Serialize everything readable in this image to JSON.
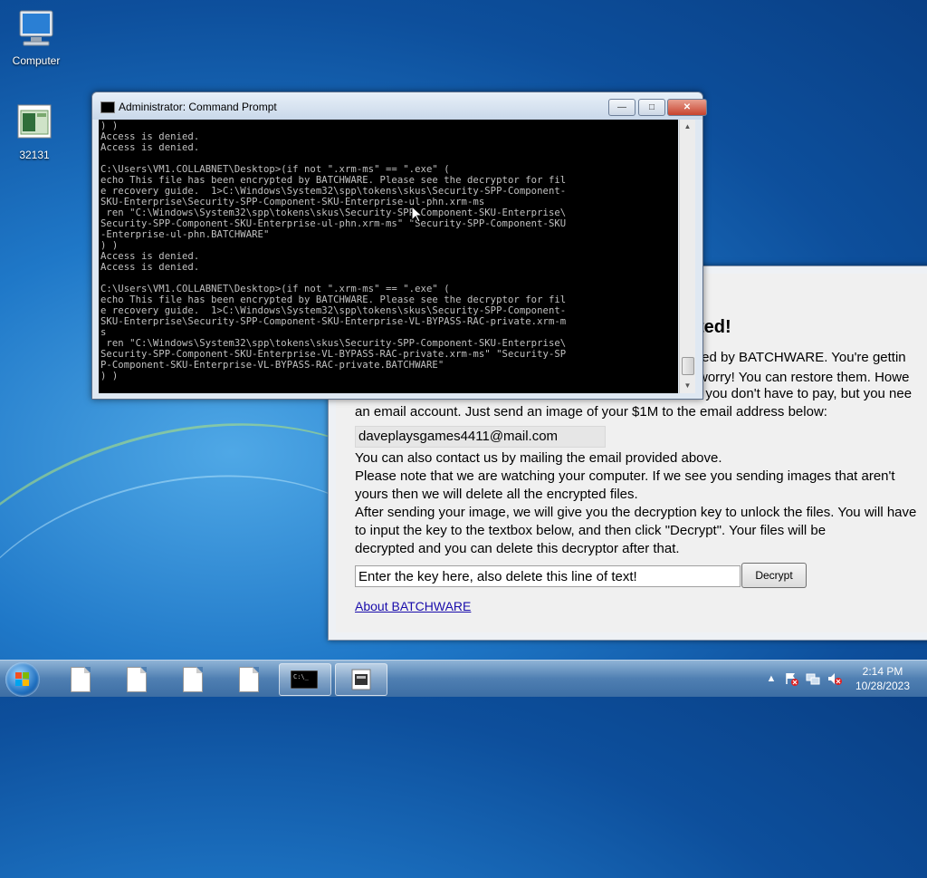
{
  "desktop": {
    "icons": [
      {
        "label": "Computer"
      },
      {
        "label": "32131"
      }
    ]
  },
  "batchware": {
    "headline": "ted!",
    "lines": [
      "ted by BATCHWARE. You're gettin",
      "worry! You can restore them. Howe",
      ", you don't have to pay, but you nee",
      "an email account. Just send an image of your $1M to the email address below:"
    ],
    "email": "daveplaysgames4411@mail.com",
    "body_lines": [
      "You can also contact us by mailing the email provided above.",
      "Please note that we are watching your computer. If we see you sending images that aren't",
      "yours then we will delete all the encrypted files.",
      "After sending your image, we will give you the decryption key to unlock the files. You will have",
      "to input the key to the textbox below, and then click \"Decrypt\". Your files will be",
      "decrypted and you can delete this decryptor after that."
    ],
    "key_input_value": "Enter the key here, also delete this line of text!",
    "decrypt_label": "Decrypt",
    "about_link": "About BATCHWARE"
  },
  "cmd": {
    "title": "Administrator:  Command Prompt",
    "console_text": ") )\nAccess is denied.\nAccess is denied.\n\nC:\\Users\\VM1.COLLABNET\\Desktop>(if not \".xrm-ms\" == \".exe\" (\necho This file has been encrypted by BATCHWARE. Please see the decryptor for fil\ne recovery guide.  1>C:\\Windows\\System32\\spp\\tokens\\skus\\Security-SPP-Component-\nSKU-Enterprise\\Security-SPP-Component-SKU-Enterprise-ul-phn.xrm-ms\n ren \"C:\\Windows\\System32\\spp\\tokens\\skus\\Security-SPP-Component-SKU-Enterprise\\\nSecurity-SPP-Component-SKU-Enterprise-ul-phn.xrm-ms\" \"Security-SPP-Component-SKU\n-Enterprise-ul-phn.BATCHWARE\"\n) )\nAccess is denied.\nAccess is denied.\n\nC:\\Users\\VM1.COLLABNET\\Desktop>(if not \".xrm-ms\" == \".exe\" (\necho This file has been encrypted by BATCHWARE. Please see the decryptor for fil\ne recovery guide.  1>C:\\Windows\\System32\\spp\\tokens\\skus\\Security-SPP-Component-\nSKU-Enterprise\\Security-SPP-Component-SKU-Enterprise-VL-BYPASS-RAC-private.xrm-m\ns\n ren \"C:\\Windows\\System32\\spp\\tokens\\skus\\Security-SPP-Component-SKU-Enterprise\\\nSecurity-SPP-Component-SKU-Enterprise-VL-BYPASS-RAC-private.xrm-ms\" \"Security-SP\nP-Component-SKU-Enterprise-VL-BYPASS-RAC-private.BATCHWARE\"\n) )"
  },
  "taskbar": {
    "time": "2:14 PM",
    "date": "10/28/2023"
  },
  "colors": {
    "console_bg": "#000000",
    "console_fg": "#c0c0c0",
    "link": "#1a0dab"
  }
}
